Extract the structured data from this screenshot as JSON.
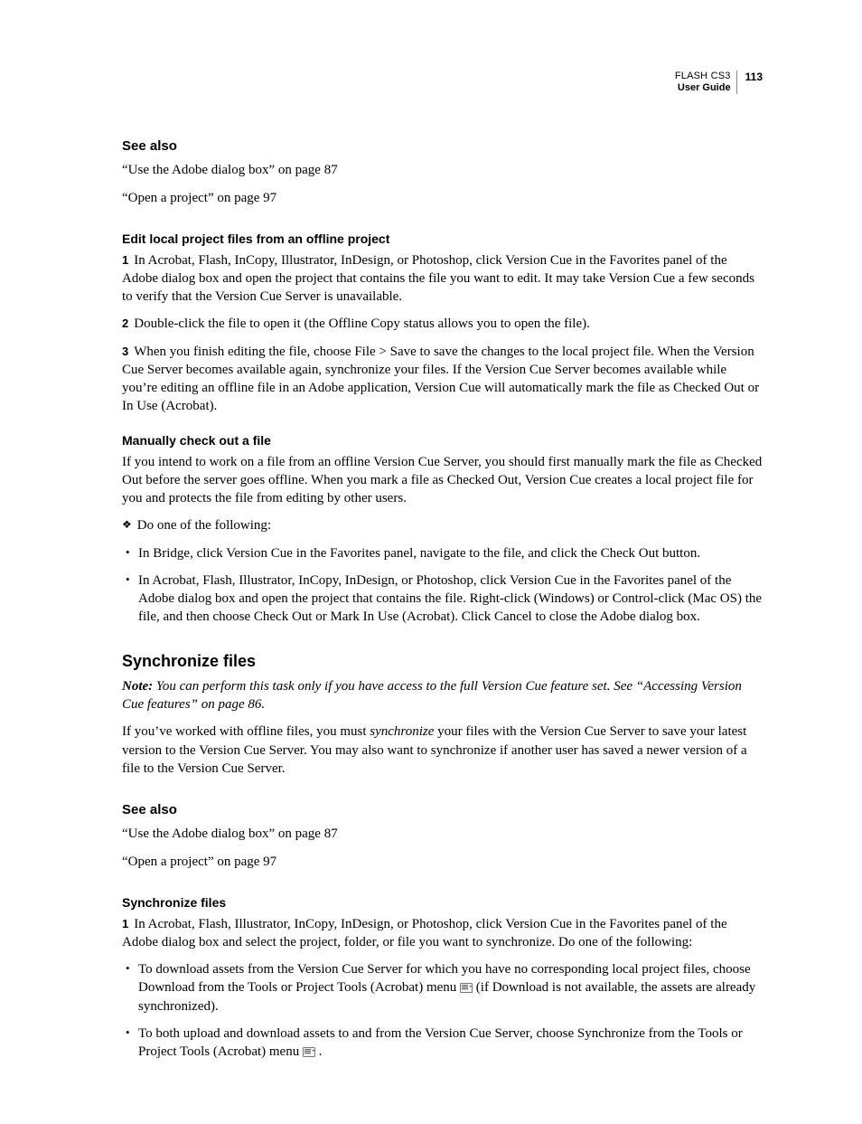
{
  "header": {
    "product": "FLASH CS3",
    "guide": "User Guide",
    "page_number": "113"
  },
  "see_also_1": {
    "heading": "See also",
    "items": [
      "“Use the Adobe dialog box” on page 87",
      "“Open a project” on page 97"
    ]
  },
  "edit_local": {
    "heading": "Edit local project files from an offline project",
    "steps": [
      "In Acrobat, Flash, InCopy, Illustrator, InDesign, or Photoshop, click Version Cue in the Favorites panel of the Adobe dialog box and open the project that contains the file you want to edit. It may take Version Cue a few seconds to verify that the Version Cue Server is unavailable.",
      "Double-click the file to open it (the Offline Copy status allows you to open the file).",
      "When you finish editing the file, choose File > Save to save the changes to the local project file. When the Version Cue Server becomes available again, synchronize your files. If the Version Cue Server becomes available while you’re editing an offline file in an Adobe application, Version Cue will automatically mark the file as Checked Out or In Use (Acrobat)."
    ]
  },
  "manual_checkout": {
    "heading": "Manually check out a file",
    "intro": "If you intend to work on a file from an offline Version Cue Server, you should first manually mark the file as Checked Out before the server goes offline. When you mark a file as Checked Out, Version Cue creates a local project file for you and protects the file from editing by other users.",
    "lead": "Do one of the following:",
    "bullets": [
      "In Bridge, click Version Cue in the Favorites panel, navigate to the file, and click the Check Out button.",
      "In Acrobat, Flash, Illustrator, InCopy, InDesign, or Photoshop, click Version Cue in the Favorites panel of the Adobe dialog box and open the project that contains the file. Right-click (Windows) or Control-click (Mac OS) the file, and then choose Check Out or Mark In Use (Acrobat). Click Cancel to close the Adobe dialog box."
    ]
  },
  "sync": {
    "heading": "Synchronize files",
    "note_label": "Note:",
    "note_body": " You can perform this task only if you have access to the full Version Cue feature set. See “Accessing Version Cue features” on page 86.",
    "p_before": "If you’ve worked with offline files, you must ",
    "p_em": "synchronize",
    "p_after": " your files with the Version Cue Server to save your latest version to the Version Cue Server. You may also want to synchronize if another user has saved a newer version of a file to the Version Cue Server."
  },
  "see_also_2": {
    "heading": "See also",
    "items": [
      "“Use the Adobe dialog box” on page 87",
      "“Open a project” on page 97"
    ]
  },
  "sync_files": {
    "heading": "Synchronize files",
    "step1": "In Acrobat, Flash, Illustrator, InCopy, InDesign, or Photoshop, click Version Cue in the Favorites panel of the Adobe dialog box and select the project, folder, or file you want to synchronize. Do one of the following:",
    "b1_before": "To download assets from the Version Cue Server for which you have no corresponding local project files, choose Download from the Tools or Project Tools (Acrobat) menu ",
    "b1_after": " (if Download is not available, the assets are already synchronized).",
    "b2_before": "To both upload and download assets to and from the Version Cue Server, choose Synchronize from the Tools or Project Tools (Acrobat) menu ",
    "b2_after": "."
  }
}
